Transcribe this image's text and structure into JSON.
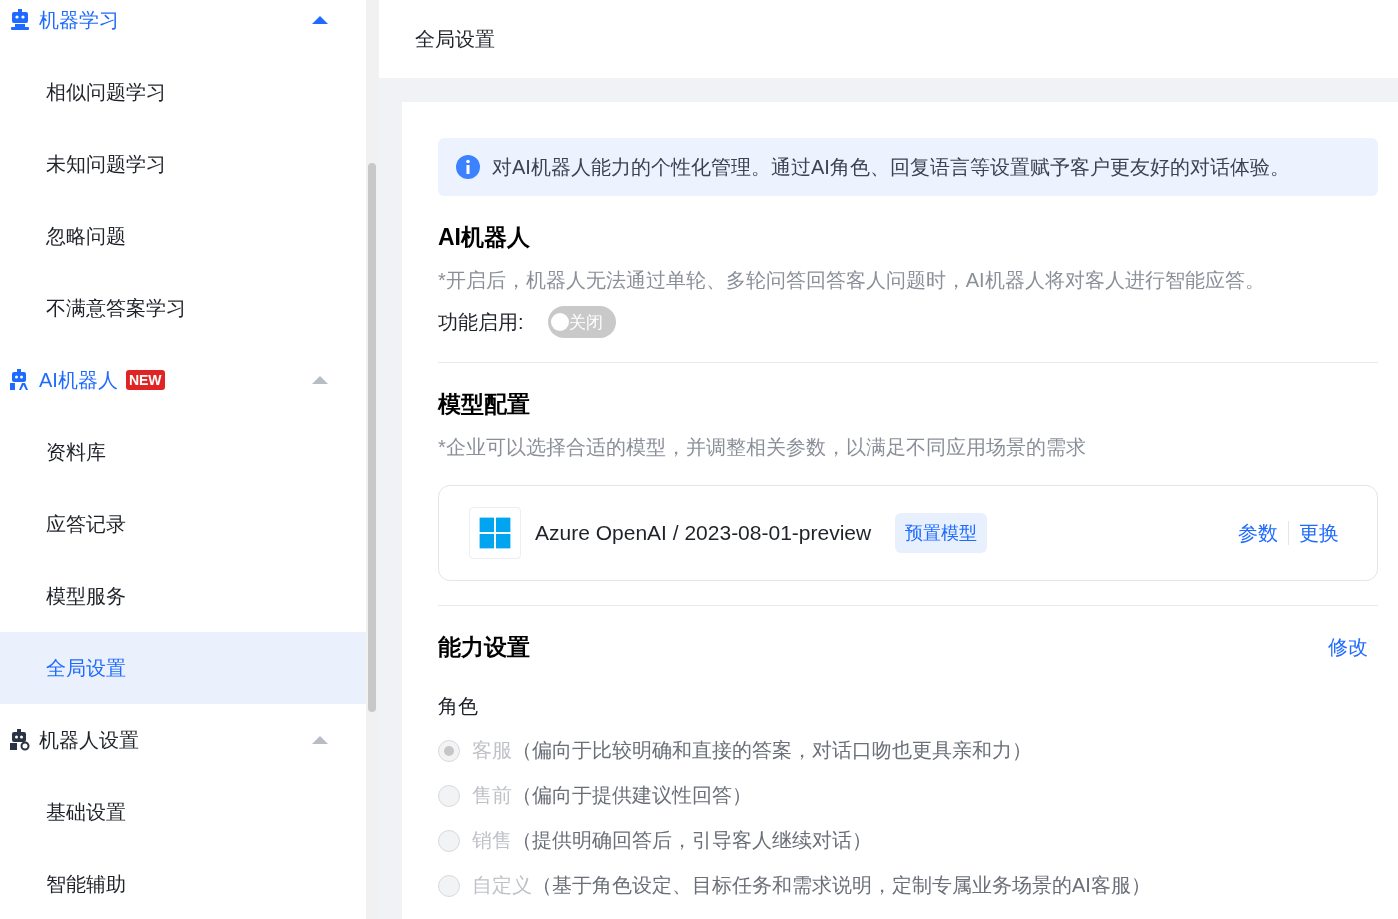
{
  "sidebar": {
    "groups": [
      {
        "label": "机器学习",
        "active": true,
        "caret_highlighted": true,
        "expanded": true,
        "items": [
          {
            "label": "相似问题学习",
            "selected": false
          },
          {
            "label": "未知问题学习",
            "selected": false
          },
          {
            "label": "忽略问题",
            "selected": false
          },
          {
            "label": "不满意答案学习",
            "selected": false
          }
        ]
      },
      {
        "label": "AI机器人",
        "active": true,
        "caret_highlighted": false,
        "badge": "NEW",
        "expanded": true,
        "items": [
          {
            "label": "资料库",
            "selected": false
          },
          {
            "label": "应答记录",
            "selected": false
          },
          {
            "label": "模型服务",
            "selected": false
          },
          {
            "label": "全局设置",
            "selected": true
          }
        ]
      },
      {
        "label": "机器人设置",
        "active": false,
        "caret_highlighted": false,
        "expanded": true,
        "items": [
          {
            "label": "基础设置",
            "selected": false
          },
          {
            "label": "智能辅助",
            "selected": false
          }
        ]
      }
    ]
  },
  "page_title": "全局设置",
  "info_banner": "对AI机器人能力的个性化管理。通过AI角色、回复语言等设置赋予客户更友好的对话体验。",
  "ai_robot": {
    "title": "AI机器人",
    "description": "*开启后，机器人无法通过单轮、多轮问答回答客人问题时，AI机器人将对客人进行智能应答。",
    "toggle_label": "功能启用:",
    "toggle": {
      "on": false,
      "text": "关闭"
    }
  },
  "model_config": {
    "title": "模型配置",
    "description": "*企业可以选择合适的模型，并调整相关参数，以满足不同应用场景的需求",
    "model": {
      "name": "Azure OpenAI / 2023-08-01-preview",
      "tag": "预置模型",
      "links": [
        "参数",
        "更换"
      ]
    }
  },
  "ability": {
    "title": "能力设置",
    "edit_link": "修改",
    "role_label": "角色",
    "roles": [
      {
        "label": "客服",
        "description": "（偏向于比较明确和直接的答案，对话口吻也更具亲和力）",
        "selected": true,
        "disabled": true
      },
      {
        "label": "售前",
        "description": "（偏向于提供建议性回答）",
        "selected": false,
        "disabled": true
      },
      {
        "label": "销售",
        "description": "（提供明确回答后，引导客人继续对话）",
        "selected": false,
        "disabled": true
      },
      {
        "label": "自定义",
        "description": "（基于角色设定、目标任务和需求说明，定制专属业务场景的AI客服）",
        "selected": false,
        "disabled": true
      }
    ]
  }
}
